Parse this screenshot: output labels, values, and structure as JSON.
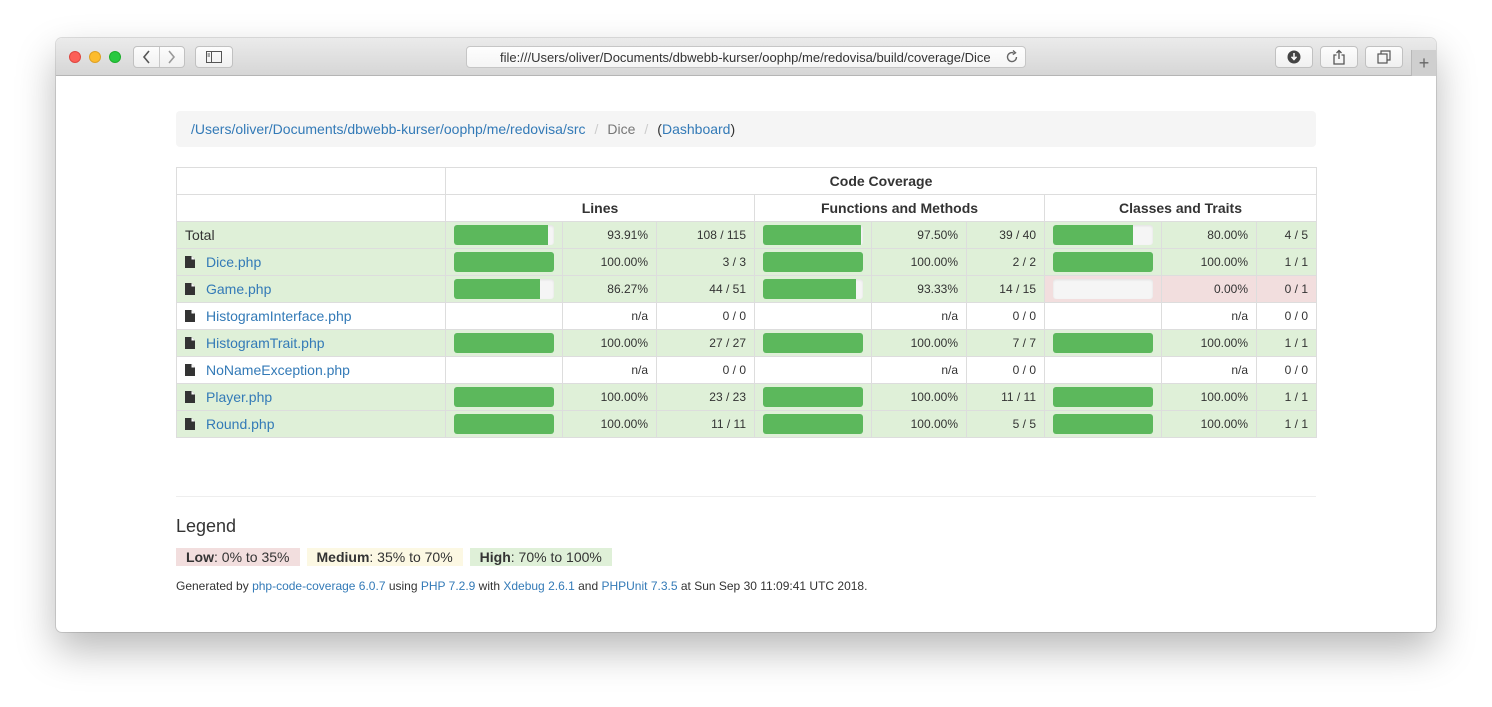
{
  "browser": {
    "url": "file:///Users/oliver/Documents/dbwebb-kurser/oophp/me/redovisa/build/coverage/Dice/"
  },
  "breadcrumb": {
    "path_link": "/Users/oliver/Documents/dbwebb-kurser/oophp/me/redovisa/src",
    "separator": "/",
    "current": "Dice",
    "open_paren": "(",
    "dashboard": "Dashboard",
    "close_paren": ")"
  },
  "table": {
    "header_main": "Code Coverage",
    "header_lines": "Lines",
    "header_functions": "Functions and Methods",
    "header_classes": "Classes and Traits",
    "rows": [
      {
        "name": "Total",
        "is_file": false,
        "status": "success",
        "lines": {
          "bar": 93.91,
          "pct": "93.91%",
          "count": "108 / 115"
        },
        "functions": {
          "bar": 97.5,
          "pct": "97.50%",
          "count": "39 / 40"
        },
        "classes": {
          "bar": 80,
          "pct": "80.00%",
          "count": "4 / 5",
          "status": "success"
        }
      },
      {
        "name": "Dice.php",
        "is_file": true,
        "status": "success",
        "lines": {
          "bar": 100,
          "pct": "100.00%",
          "count": "3 / 3"
        },
        "functions": {
          "bar": 100,
          "pct": "100.00%",
          "count": "2 / 2"
        },
        "classes": {
          "bar": 100,
          "pct": "100.00%",
          "count": "1 / 1",
          "status": "success"
        }
      },
      {
        "name": "Game.php",
        "is_file": true,
        "status": "success",
        "lines": {
          "bar": 86.27,
          "pct": "86.27%",
          "count": "44 / 51"
        },
        "functions": {
          "bar": 93.33,
          "pct": "93.33%",
          "count": "14 / 15"
        },
        "classes": {
          "bar": 0,
          "pct": "0.00%",
          "count": "0 / 1",
          "status": "danger"
        }
      },
      {
        "name": "HistogramInterface.php",
        "is_file": true,
        "status": "plain",
        "lines": {
          "bar": null,
          "pct": "n/a",
          "count": "0 / 0"
        },
        "functions": {
          "bar": null,
          "pct": "n/a",
          "count": "0 / 0"
        },
        "classes": {
          "bar": null,
          "pct": "n/a",
          "count": "0 / 0",
          "status": "plain"
        }
      },
      {
        "name": "HistogramTrait.php",
        "is_file": true,
        "status": "success",
        "lines": {
          "bar": 100,
          "pct": "100.00%",
          "count": "27 / 27"
        },
        "functions": {
          "bar": 100,
          "pct": "100.00%",
          "count": "7 / 7"
        },
        "classes": {
          "bar": 100,
          "pct": "100.00%",
          "count": "1 / 1",
          "status": "success"
        }
      },
      {
        "name": "NoNameException.php",
        "is_file": true,
        "status": "plain",
        "lines": {
          "bar": null,
          "pct": "n/a",
          "count": "0 / 0"
        },
        "functions": {
          "bar": null,
          "pct": "n/a",
          "count": "0 / 0"
        },
        "classes": {
          "bar": null,
          "pct": "n/a",
          "count": "0 / 0",
          "status": "plain"
        }
      },
      {
        "name": "Player.php",
        "is_file": true,
        "status": "success",
        "lines": {
          "bar": 100,
          "pct": "100.00%",
          "count": "23 / 23"
        },
        "functions": {
          "bar": 100,
          "pct": "100.00%",
          "count": "11 / 11"
        },
        "classes": {
          "bar": 100,
          "pct": "100.00%",
          "count": "1 / 1",
          "status": "success"
        }
      },
      {
        "name": "Round.php",
        "is_file": true,
        "status": "success",
        "lines": {
          "bar": 100,
          "pct": "100.00%",
          "count": "11 / 11"
        },
        "functions": {
          "bar": 100,
          "pct": "100.00%",
          "count": "5 / 5"
        },
        "classes": {
          "bar": 100,
          "pct": "100.00%",
          "count": "1 / 1",
          "status": "success"
        }
      }
    ]
  },
  "legend": {
    "title": "Legend",
    "low_label": "Low",
    "low_range": ": 0% to 35%",
    "medium_label": "Medium",
    "medium_range": ": 35% to 70%",
    "high_label": "High",
    "high_range": ": 70% to 100%"
  },
  "footer": {
    "prefix": "Generated by ",
    "tool": "php-code-coverage 6.0.7",
    "using": " using ",
    "php": "PHP 7.2.9",
    "with": " with ",
    "xdebug": "Xdebug 2.6.1",
    "and": " and ",
    "phpunit": "PHPUnit 7.3.5",
    "suffix": " at Sun Sep 30 11:09:41 UTC 2018."
  },
  "colors": {
    "success_bg": "#dff0d8",
    "danger_bg": "#f2dede",
    "warning_bg": "#fcf8e3",
    "bar_fill": "#5cb85c",
    "link": "#337ab7"
  }
}
